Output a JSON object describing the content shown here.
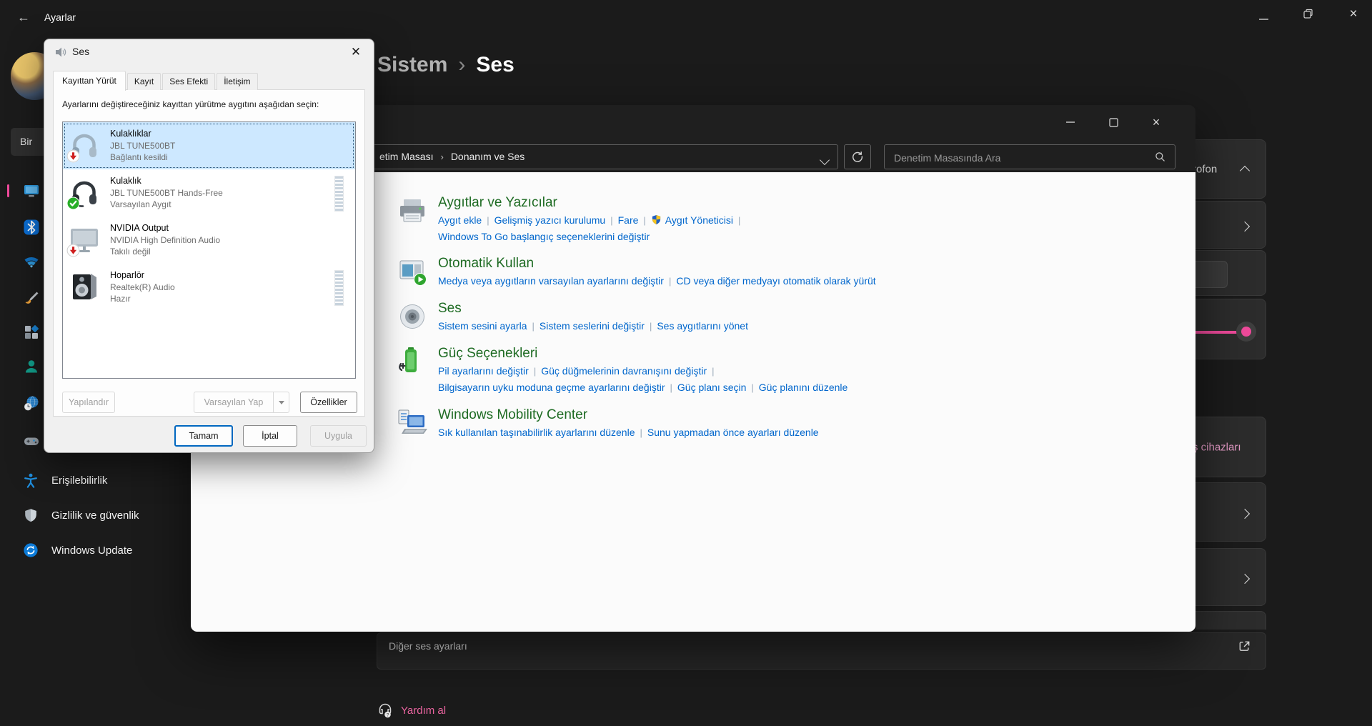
{
  "app": {
    "title": "Ayarlar"
  },
  "colors": {
    "accent_pink": "#ef4a9b",
    "link_pink_light": "#e79cc8",
    "cp_link_blue": "#0066cc",
    "cp_heading_green": "#1e6b23",
    "selected_item_bg": "#cde8ff"
  },
  "settings": {
    "header": {
      "parent": "Sistem",
      "separator": "›",
      "current": "Ses"
    },
    "sidebar": {
      "search_fragment": "Bir",
      "rail": [
        {
          "id": "system",
          "icon": "system-icon",
          "active": true
        },
        {
          "id": "bluetooth",
          "icon": "bluetooth-icon",
          "active": false
        },
        {
          "id": "network",
          "icon": "network-icon",
          "active": false
        },
        {
          "id": "personalization",
          "icon": "personalization-icon",
          "active": false
        },
        {
          "id": "apps",
          "icon": "apps-icon",
          "active": false
        },
        {
          "id": "accounts",
          "icon": "accounts-icon",
          "active": false
        },
        {
          "id": "time-language",
          "icon": "time-language-icon",
          "active": false
        },
        {
          "id": "gaming",
          "icon": "gaming-icon",
          "active": false
        }
      ],
      "nav": [
        {
          "id": "accessibility",
          "label": "Erişilebilirlik",
          "icon": "accessibility-icon"
        },
        {
          "id": "privacy",
          "label": "Gizlilik ve güvenlik",
          "icon": "shield-icon"
        },
        {
          "id": "windows-update",
          "label": "Windows Update",
          "icon": "update-icon"
        }
      ]
    },
    "cards": {
      "mic_fragment": "rofon",
      "devices_fragment": "ş cihazları",
      "other_sound": "Diğer ses ayarları",
      "help": "Yardım al"
    }
  },
  "control_panel": {
    "address": {
      "fragment": "etim Masası",
      "separator": "›",
      "current": "Donanım ve Ses"
    },
    "search_placeholder": "Denetim Masasında Ara",
    "sections": [
      {
        "title": "Aygıtlar ve Yazıcılar",
        "icon": "devices-printers-icon",
        "rows": [
          {
            "links": [
              {
                "t": "Aygıt ekle"
              },
              {
                "t": "Gelişmiş yazıcı kurulumu"
              },
              {
                "t": "Fare"
              },
              {
                "t": "Aygıt Yöneticisi",
                "shield": true
              }
            ],
            "trailing": true
          },
          {
            "links": [
              {
                "t": "Windows To Go başlangıç seçeneklerini değiştir"
              }
            ],
            "trailing": false
          }
        ]
      },
      {
        "title": "Otomatik Kullan",
        "icon": "autoplay-icon",
        "rows": [
          {
            "links": [
              {
                "t": "Medya veya aygıtların varsayılan ayarlarını değiştir"
              },
              {
                "t": "CD veya diğer medyayı otomatik olarak yürüt"
              }
            ],
            "trailing": false
          }
        ]
      },
      {
        "title": "Ses",
        "icon": "sound-icon",
        "rows": [
          {
            "links": [
              {
                "t": "Sistem sesini ayarla"
              },
              {
                "t": "Sistem seslerini değiştir"
              },
              {
                "t": "Ses aygıtlarını yönet"
              }
            ],
            "trailing": false
          }
        ]
      },
      {
        "title": "Güç Seçenekleri",
        "icon": "power-icon",
        "rows": [
          {
            "links": [
              {
                "t": "Pil ayarlarını değiştir"
              },
              {
                "t": "Güç düğmelerinin davranışını değiştir"
              }
            ],
            "trailing": true
          },
          {
            "links": [
              {
                "t": "Bilgisayarın uyku moduna geçme ayarlarını değiştir"
              },
              {
                "t": "Güç planı seçin"
              },
              {
                "t": "Güç planını düzenle"
              }
            ],
            "trailing": false
          }
        ]
      },
      {
        "title": "Windows Mobility Center",
        "icon": "mobility-icon",
        "rows": [
          {
            "links": [
              {
                "t": "Sık kullanılan taşınabilirlik ayarlarını düzenle"
              },
              {
                "t": "Sunu yapmadan önce ayarları düzenle"
              }
            ],
            "trailing": false
          }
        ]
      }
    ]
  },
  "sound_dialog": {
    "title": "Ses",
    "tabs": [
      "Kayıttan Yürüt",
      "Kayıt",
      "Ses Efekti",
      "İletişim"
    ],
    "active_tab": 0,
    "instruction": "Ayarlarını değiştireceğiniz kayıttan yürütme aygıtını aşağıdan seçin:",
    "devices": [
      {
        "name": "Kulaklıklar",
        "detail": "JBL TUNE500BT",
        "status": "Bağlantı kesildi",
        "icon": "headphones",
        "badge": "disconnected",
        "selected": true,
        "meter": false
      },
      {
        "name": "Kulaklık",
        "detail": "JBL TUNE500BT Hands-Free",
        "status": "Varsayılan Aygıt",
        "icon": "headset",
        "badge": "default",
        "selected": false,
        "meter": true
      },
      {
        "name": "NVIDIA Output",
        "detail": "NVIDIA High Definition Audio",
        "status": "Takılı değil",
        "icon": "monitor",
        "badge": "disconnected",
        "selected": false,
        "meter": false
      },
      {
        "name": "Hoparlör",
        "detail": "Realtek(R) Audio",
        "status": "Hazır",
        "icon": "speaker",
        "badge": null,
        "selected": false,
        "meter": true
      }
    ],
    "buttons": {
      "configure": "Yapılandır",
      "set_default": "Varsayılan Yap",
      "properties": "Özellikler",
      "ok": "Tamam",
      "cancel": "İptal",
      "apply": "Uygula"
    }
  }
}
